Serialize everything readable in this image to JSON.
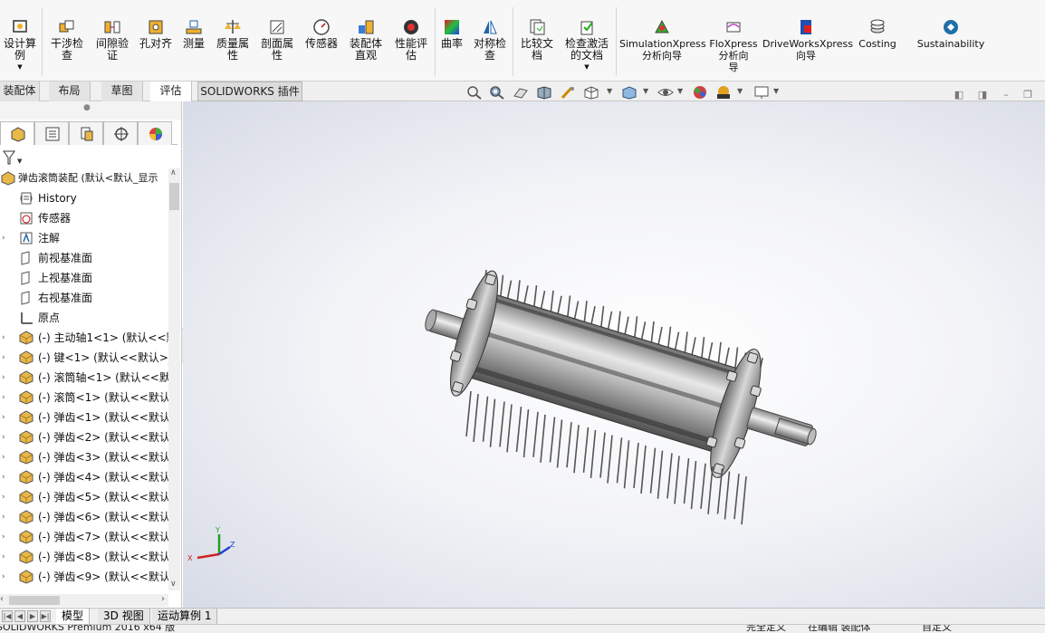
{
  "ribbon": {
    "buttons": [
      {
        "name": "design-study",
        "label": "设计算\n例"
      },
      {
        "name": "interference-check",
        "label": "干涉检\n查"
      },
      {
        "name": "clearance-verification",
        "label": "间隙验\n证"
      },
      {
        "name": "hole-alignment",
        "label": "孔对齐"
      },
      {
        "name": "measure",
        "label": "测量"
      },
      {
        "name": "mass-properties",
        "label": "质量属\n性"
      },
      {
        "name": "section-properties",
        "label": "剖面属\n性"
      },
      {
        "name": "sensor",
        "label": "传感器"
      },
      {
        "name": "assembly-visualization",
        "label": "装配体\n直观"
      },
      {
        "name": "performance-evaluation",
        "label": "性能评\n估"
      },
      {
        "name": "curvature",
        "label": "曲率"
      },
      {
        "name": "symmetry-check",
        "label": "对称检\n查"
      },
      {
        "name": "compare-documents",
        "label": "比较文\n档"
      },
      {
        "name": "check-active-document",
        "label": "检查激活\n的文档"
      },
      {
        "name": "simulationxpress",
        "label": "SimulationXpress\n分析向导"
      },
      {
        "name": "floxpress",
        "label": "FloXpress\n分析向\n导"
      },
      {
        "name": "driveworksxpress",
        "label": "DriveWorksXpress\n向导"
      },
      {
        "name": "costing",
        "label": "Costing"
      },
      {
        "name": "sustainability",
        "label": "Sustainability"
      }
    ]
  },
  "tabs": [
    "装配体",
    "布局",
    "草图",
    "评估",
    "SOLIDWORKS 插件"
  ],
  "tree": {
    "root": "弹齿滚筒装配  (默认<默认_显示",
    "items": [
      {
        "label": "History",
        "icon": "history-icon"
      },
      {
        "label": "传感器",
        "icon": "sensor-icon"
      },
      {
        "label": "注解",
        "icon": "annotation-icon",
        "expandable": true
      },
      {
        "label": "前视基准面",
        "icon": "plane-icon"
      },
      {
        "label": "上视基准面",
        "icon": "plane-icon"
      },
      {
        "label": "右视基准面",
        "icon": "plane-icon"
      },
      {
        "label": "原点",
        "icon": "origin-icon"
      },
      {
        "label": "(-) 主动轴1<1>  (默认<<默",
        "icon": "part-icon",
        "expandable": true
      },
      {
        "label": "(-) 键<1>  (默认<<默认>_",
        "icon": "part-icon",
        "expandable": true
      },
      {
        "label": "(-) 滚筒轴<1>  (默认<<默认",
        "icon": "part-icon",
        "expandable": true
      },
      {
        "label": "(-) 滚筒<1>  (默认<<默认",
        "icon": "part-icon",
        "expandable": true
      },
      {
        "label": "(-) 弹齿<1>  (默认<<默认",
        "icon": "part-icon",
        "expandable": true
      },
      {
        "label": "(-) 弹齿<2>  (默认<<默认",
        "icon": "part-icon",
        "expandable": true
      },
      {
        "label": "(-) 弹齿<3>  (默认<<默认",
        "icon": "part-icon",
        "expandable": true
      },
      {
        "label": "(-) 弹齿<4>  (默认<<默认",
        "icon": "part-icon",
        "expandable": true
      },
      {
        "label": "(-) 弹齿<5>  (默认<<默认",
        "icon": "part-icon",
        "expandable": true
      },
      {
        "label": "(-) 弹齿<6>  (默认<<默认",
        "icon": "part-icon",
        "expandable": true
      },
      {
        "label": "(-) 弹齿<7>  (默认<<默认",
        "icon": "part-icon",
        "expandable": true
      },
      {
        "label": "(-) 弹齿<8>  (默认<<默认",
        "icon": "part-icon",
        "expandable": true
      },
      {
        "label": "(-) 弹齿<9>  (默认<<默认",
        "icon": "part-icon",
        "expandable": true
      }
    ]
  },
  "bottom_tabs": [
    "模型",
    "3D 视图",
    "运动算例 1"
  ],
  "status": {
    "app": "SOLIDWORKS Premium 2016 x64 版",
    "defined": "完全定义",
    "editing": "在编辑 装配体",
    "custom": "自定义"
  },
  "triad": {
    "x": "X",
    "y": "Y",
    "z": "Z"
  },
  "colors": {
    "accent": "#1f5fbf",
    "part": "#e8b84a"
  }
}
